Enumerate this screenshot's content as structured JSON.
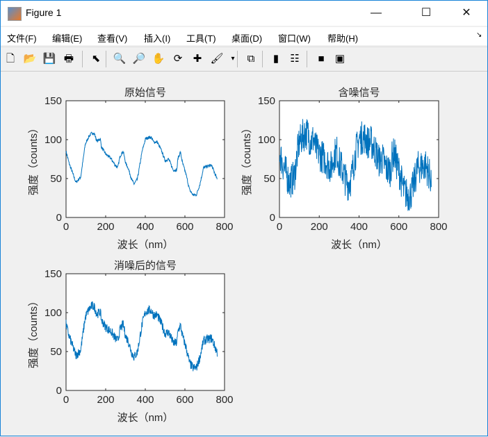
{
  "window": {
    "title": "Figure 1",
    "minimize": "—",
    "maximize": "☐",
    "close": "✕"
  },
  "menus": [
    "文件(F)",
    "编辑(E)",
    "查看(V)",
    "插入(I)",
    "工具(T)",
    "桌面(D)",
    "窗口(W)",
    "帮助(H)"
  ],
  "menu_arrow": "↘",
  "toolbar": [
    {
      "name": "new-figure-icon",
      "glyph": "🗋"
    },
    {
      "name": "open-icon",
      "glyph": "📂"
    },
    {
      "name": "save-icon",
      "glyph": "💾"
    },
    {
      "name": "print-icon",
      "glyph": "🖶"
    },
    {
      "name": "edit-plot-icon",
      "glyph": "⬉"
    },
    {
      "name": "zoom-in-icon",
      "glyph": "🔍"
    },
    {
      "name": "zoom-out-icon",
      "glyph": "🔎"
    },
    {
      "name": "pan-icon",
      "glyph": "✋"
    },
    {
      "name": "rotate-3d-icon",
      "glyph": "⟳"
    },
    {
      "name": "data-cursor-icon",
      "glyph": "✚"
    },
    {
      "name": "brush-icon",
      "glyph": "🖌"
    },
    {
      "name": "brush-dropdown-icon",
      "glyph": "▾"
    },
    {
      "name": "link-plot-icon",
      "glyph": "⧉"
    },
    {
      "name": "colorbar-icon",
      "glyph": "▮"
    },
    {
      "name": "legend-icon",
      "glyph": "☷"
    },
    {
      "name": "hide-plot-tools-icon",
      "glyph": "■"
    },
    {
      "name": "show-plot-tools-icon",
      "glyph": "▣"
    }
  ],
  "chart_data": [
    {
      "type": "line",
      "title": "原始信号",
      "xlabel": "波长（nm）",
      "ylabel": "强度（counts）",
      "xlim": [
        0,
        800
      ],
      "ylim": [
        0,
        150
      ],
      "xticks": [
        0,
        200,
        400,
        600,
        800
      ],
      "yticks": [
        0,
        50,
        100,
        150
      ],
      "color": "#0072bd",
      "noise": 2,
      "x": [
        0,
        15,
        50,
        74,
        97,
        115,
        132,
        144,
        156,
        173,
        179,
        202,
        226,
        249,
        261,
        273,
        288,
        302,
        313,
        331,
        343,
        360,
        384,
        401,
        419,
        430,
        442,
        460,
        483,
        500,
        518,
        541,
        559,
        565,
        577,
        588,
        606,
        624,
        641,
        658,
        676,
        694,
        717,
        735,
        764
      ],
      "y": [
        85,
        70,
        45,
        52,
        94,
        104,
        109,
        107,
        98,
        101,
        90,
        81,
        76,
        67,
        64,
        79,
        85,
        69,
        64,
        49,
        43,
        49,
        85,
        101,
        103,
        103,
        97,
        97,
        85,
        73,
        75,
        61,
        61,
        76,
        84,
        70,
        55,
        35,
        29,
        29,
        43,
        64,
        66,
        67,
        48
      ]
    },
    {
      "type": "line",
      "title": "含噪信号",
      "xlabel": "波长（nm）",
      "ylabel": "强度（counts）",
      "xlim": [
        0,
        800
      ],
      "ylim": [
        0,
        150
      ],
      "xticks": [
        0,
        200,
        400,
        600,
        800
      ],
      "yticks": [
        0,
        50,
        100,
        150
      ],
      "color": "#0072bd",
      "noise": 22,
      "base": "原始信号"
    },
    {
      "type": "line",
      "title": "消噪后的信号",
      "xlabel": "波长（nm）",
      "ylabel": "强度（counts）",
      "xlim": [
        0,
        800
      ],
      "ylim": [
        0,
        150
      ],
      "xticks": [
        0,
        200,
        400,
        600,
        800
      ],
      "yticks": [
        0,
        50,
        100,
        150
      ],
      "color": "#0072bd",
      "noise": 6,
      "base": "原始信号"
    }
  ]
}
